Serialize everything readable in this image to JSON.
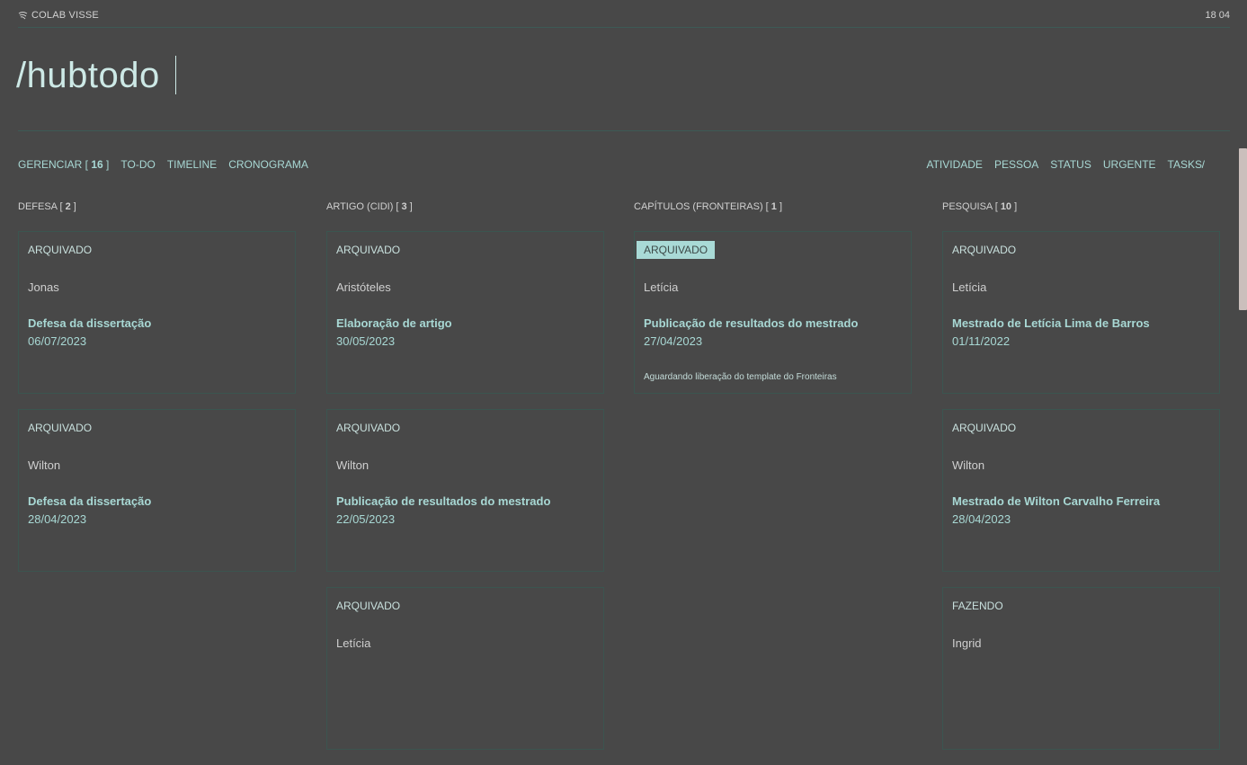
{
  "header": {
    "brand": "COLAB VISSE",
    "clock": "18 04"
  },
  "hero": {
    "title": "/hubtodo"
  },
  "nav_left": [
    {
      "label": "GERENCIAR [ ",
      "count": "16",
      "suffix": " ]"
    },
    {
      "label": "TO-DO"
    },
    {
      "label": "TIMELINE"
    },
    {
      "label": "CRONOGRAMA"
    }
  ],
  "nav_right": [
    "ATIVIDADE",
    "PESSOA",
    "STATUS",
    "URGENTE",
    "TASKS"
  ],
  "nav_slash": "/",
  "columns": [
    {
      "label": "DEFESA [ ",
      "count": "2",
      "suffix": " ]",
      "cards": [
        {
          "status": "ARQUIVADO",
          "person": "Jonas",
          "title": "Defesa da dissertação",
          "date": "06/07/2023"
        },
        {
          "status": "ARQUIVADO",
          "person": "Wilton",
          "title": "Defesa da dissertação",
          "date": "28/04/2023"
        }
      ]
    },
    {
      "label": "ARTIGO (CIDI) [ ",
      "count": "3",
      "suffix": " ]",
      "cards": [
        {
          "status": "ARQUIVADO",
          "person": "Aristóteles",
          "title": "Elaboração de artigo",
          "date": "30/05/2023"
        },
        {
          "status": "ARQUIVADO",
          "person": "Wilton",
          "title": "Publicação de resultados do mestrado",
          "date": "22/05/2023"
        },
        {
          "status": "ARQUIVADO",
          "person": "Letícia"
        }
      ]
    },
    {
      "label": "CAPÍTULOS (FRONTEIRAS) [ ",
      "count": "1",
      "suffix": " ]",
      "cards": [
        {
          "status": "ARQUIVADO",
          "person": "Letícia",
          "title": "Publicação de resultados do mestrado",
          "date": "27/04/2023",
          "note": "Aguardando liberação do template do Fronteiras"
        }
      ]
    },
    {
      "label": "PESQUISA [ ",
      "count": "10",
      "suffix": " ]",
      "cards": [
        {
          "status": "ARQUIVADO",
          "person": "Letícia",
          "title": "Mestrado de Letícia Lima de Barros",
          "date": "01/11/2022"
        },
        {
          "status": "ARQUIVADO",
          "person": "Wilton",
          "title": "Mestrado de Wilton Carvalho Ferreira",
          "date": "28/04/2023"
        },
        {
          "status": "FAZENDO",
          "person": "Ingrid"
        }
      ]
    }
  ]
}
